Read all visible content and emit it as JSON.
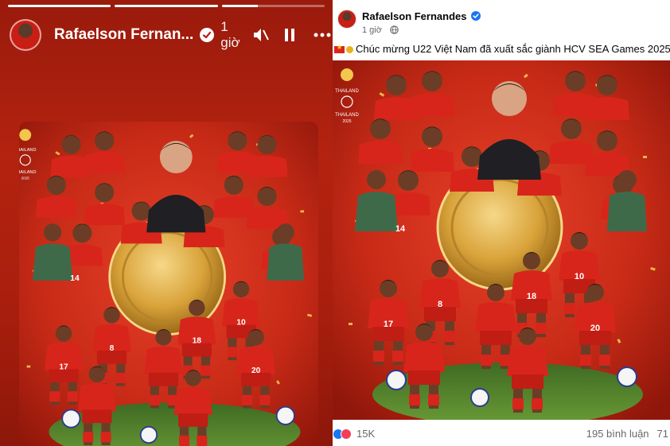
{
  "story": {
    "progress": [
      1.0,
      1.0,
      0.35
    ],
    "author": "Rafaelson Fernan...",
    "time": "1 giờ",
    "icons": [
      "verified-icon",
      "globe-icon",
      "volume-muted-icon",
      "pause-icon",
      "more-icon"
    ]
  },
  "post": {
    "author": "Rafaelson Fernandes",
    "time": "1 giờ",
    "text": "Chúc mừng U22 Việt Nam đã xuất sắc giành HCV SEA Games 2025!",
    "reactions": "15K",
    "comments": "195 bình luận",
    "shares": "71",
    "icons": [
      "verified-icon",
      "globe-icon",
      "vietnam-flag-icon",
      "medal-icon",
      "like-reaction-icon",
      "love-reaction-icon"
    ]
  },
  "poster": {
    "logo_text": "THAILAND",
    "logo_sub": "2025",
    "player_numbers": [
      "17",
      "8",
      "18",
      "10",
      "20",
      "14"
    ],
    "colors": {
      "kit": "#d8251b",
      "background": "#b3230f",
      "medal": "#d9a33a",
      "pitch": "#5b8a2e"
    }
  }
}
